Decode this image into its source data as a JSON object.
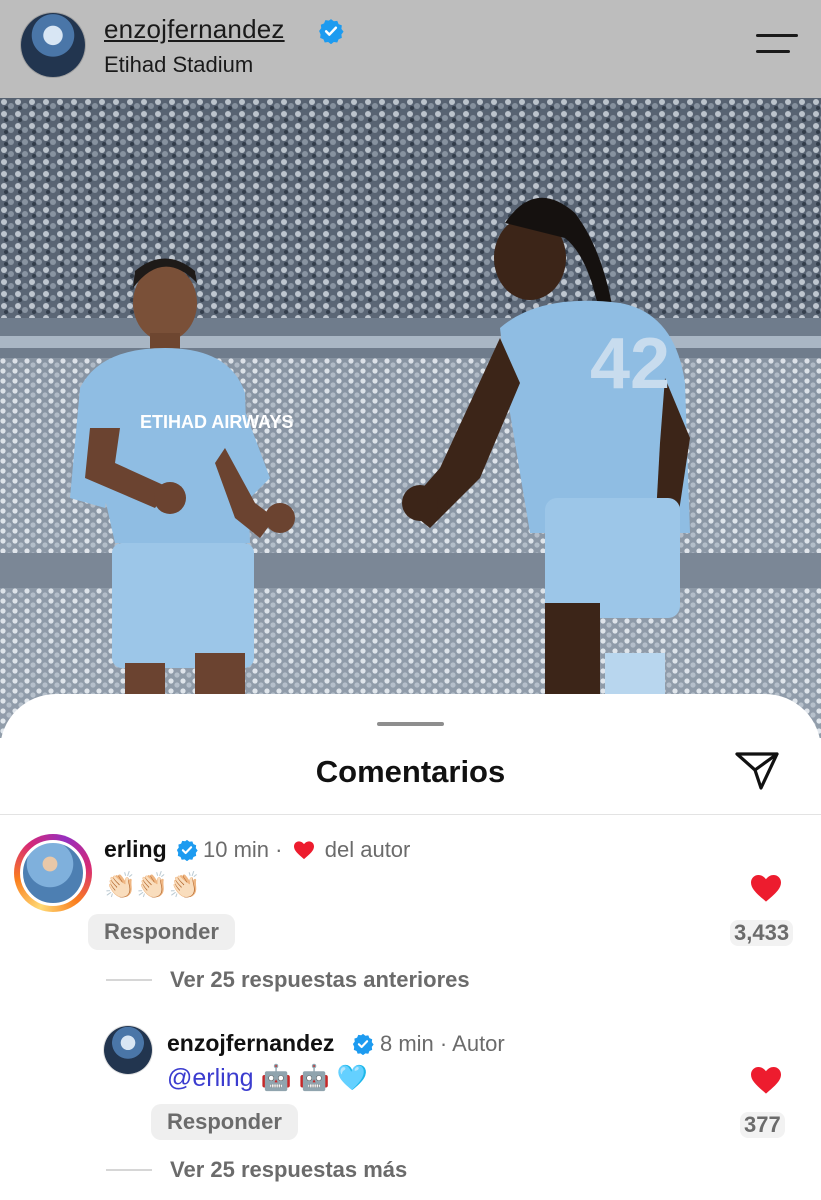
{
  "header": {
    "username": "enzojfernandez",
    "location": "Etihad Stadium"
  },
  "photo": {
    "jersey_text": "ETIHAD AIRWAYS",
    "back_number": "42"
  },
  "comments_sheet": {
    "title": "Comentarios",
    "comments": [
      {
        "username": "erling",
        "time": "10 min",
        "separator": "·",
        "author_like_label": "del autor",
        "text": "👏🏻👏🏻👏🏻",
        "reply_label": "Responder",
        "like_count": "3,433",
        "view_replies": "Ver 25 respuestas anteriores"
      }
    ],
    "reply": {
      "username": "enzojfernandez",
      "time": "8 min",
      "separator": "·",
      "author_label": "Autor",
      "mention": "@erling",
      "text_rest": " 🤖 🤖 🩵",
      "reply_label": "Responder",
      "like_count": "377"
    },
    "view_more": "Ver 25 respuestas más"
  },
  "colors": {
    "verified_blue": "#1d9bf0",
    "heart_red": "#ed1c2e",
    "mention_blue": "#3b3ccf"
  }
}
